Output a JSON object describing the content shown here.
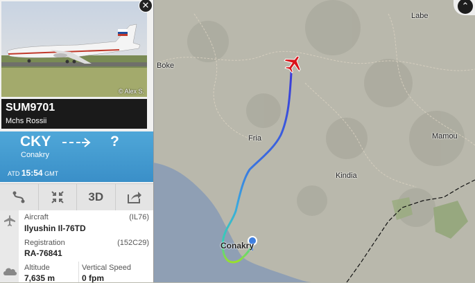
{
  "map": {
    "places": [
      "Labe",
      "Boke",
      "Fria",
      "Mamou",
      "Kindia",
      "Conakry"
    ]
  },
  "flight": {
    "callsign": "SUM9701",
    "airline": "Mchs Rossii",
    "photo_credit": "© Alex S."
  },
  "route": {
    "from_code": "CKY",
    "from_name": "Conakry",
    "to_code": "?",
    "atd_label": "ATD",
    "atd_time": "15:54",
    "atd_zone": "GMT"
  },
  "toolbar": {
    "three_d_label": "3D"
  },
  "details": {
    "aircraft_label": "Aircraft",
    "aircraft_value": "Ilyushin Il-76TD",
    "aircraft_code": "(IL76)",
    "registration_label": "Registration",
    "registration_value": "RA-76841",
    "registration_code": "(152C29)",
    "altitude_label": "Altitude",
    "altitude_value": "7,635 m",
    "vspeed_label": "Vertical Speed",
    "vspeed_value": "0 fpm"
  },
  "colors": {
    "track_high": "#3a48d8",
    "track_mid": "#3aa0e0",
    "track_low": "#9ae02a",
    "plane": "#d9141b",
    "sea": "#8f9fb4"
  }
}
